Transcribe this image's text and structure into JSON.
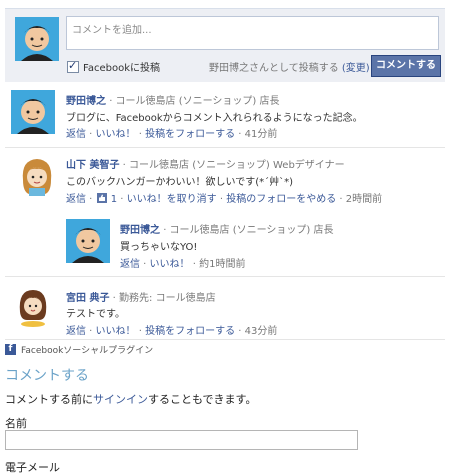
{
  "composer": {
    "placeholder": "コメントを追加...",
    "post_to_facebook": "Facebookに投稿",
    "posting_as": "野田博之さんとして投稿する",
    "change": "(変更)",
    "submit": "コメントする"
  },
  "comments": [
    {
      "author": "野田博之",
      "info": "· コール徳島店 (ソニーショップ) 店長",
      "text": "ブログに、Facebookからコメント入れられるようになった記念。",
      "actions": {
        "reply": "返信",
        "like": "いいね！",
        "follow": "投稿をフォローする",
        "time": "41分前"
      }
    },
    {
      "author": "山下 美智子",
      "info": "· コール徳島店 (ソニーショップ) Webデザイナー",
      "text": "このバックハンガーかわいい！欲しいです(*´艸`*)",
      "actions": {
        "reply": "返信",
        "like_count": "1",
        "unlike": "いいね！を取り消す",
        "unfollow": "投稿のフォローをやめる",
        "time": "2時間前"
      }
    },
    {
      "author": "野田博之",
      "info": "· コール徳島店 (ソニーショップ) 店長",
      "text": "買っちゃいなYO!",
      "actions": {
        "reply": "返信",
        "like": "いいね！",
        "time": "約1時間前"
      }
    },
    {
      "author": "宮田 典子",
      "info": "· 勤務先: コール徳島店",
      "text": "テストです。",
      "actions": {
        "reply": "返信",
        "like": "いいね！",
        "follow": "投稿をフォローする",
        "time": "43分前"
      }
    }
  ],
  "plugin": {
    "label": "Facebookソーシャルプラグイン"
  },
  "form": {
    "title": "コメントする",
    "signin_prefix": "コメントする前に",
    "signin_link": "サインイン",
    "signin_suffix": "することもできます。",
    "name_label": "名前",
    "email_label": "電子メール"
  },
  "colors": {
    "facebook_blue": "#3b5998",
    "button_blue": "#5b74a8",
    "composer_bg": "#edeff4",
    "form_title": "#6aa2c8"
  }
}
